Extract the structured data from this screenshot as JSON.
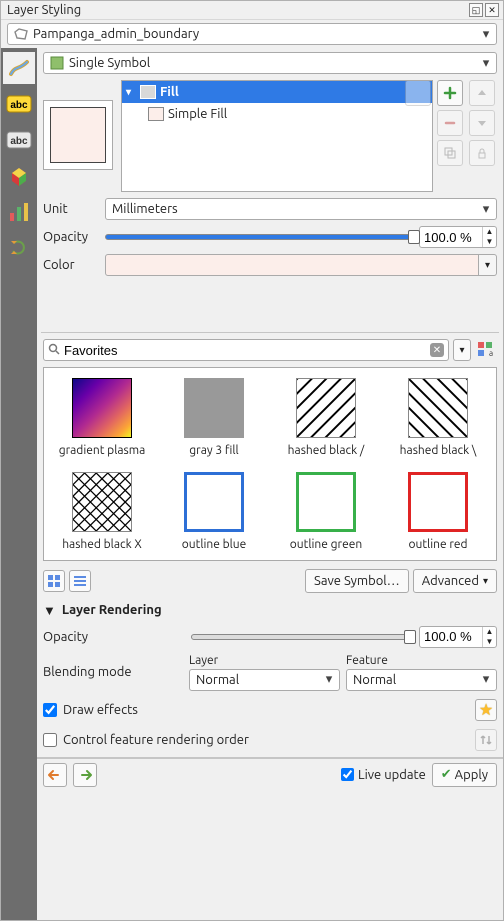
{
  "title": "Layer Styling",
  "layer_name": "Pampanga_admin_boundary",
  "renderer": "Single Symbol",
  "tree": {
    "fill": "Fill",
    "simple_fill": "Simple Fill"
  },
  "unit_label": "Unit",
  "unit_value": "Millimeters",
  "opacity_label": "Opacity",
  "opacity_value": "100.0 %",
  "color_label": "Color",
  "search_value": "Favorites",
  "gallery": [
    "gradient plasma",
    "gray 3 fill",
    "hashed black /",
    "hashed black \\",
    "hashed black X",
    "outline blue",
    "outline green",
    "outline red"
  ],
  "save_symbol": "Save Symbol…",
  "advanced": "Advanced",
  "rendering": {
    "title": "Layer Rendering",
    "opacity_label": "Opacity",
    "opacity_value": "100.0 %",
    "blend_label": "Blending mode",
    "layer_cap": "Layer",
    "feature_cap": "Feature",
    "layer_val": "Normal",
    "feature_val": "Normal",
    "draw_effects": "Draw effects",
    "control_order": "Control feature rendering order"
  },
  "live_update": "Live update",
  "apply": "Apply"
}
